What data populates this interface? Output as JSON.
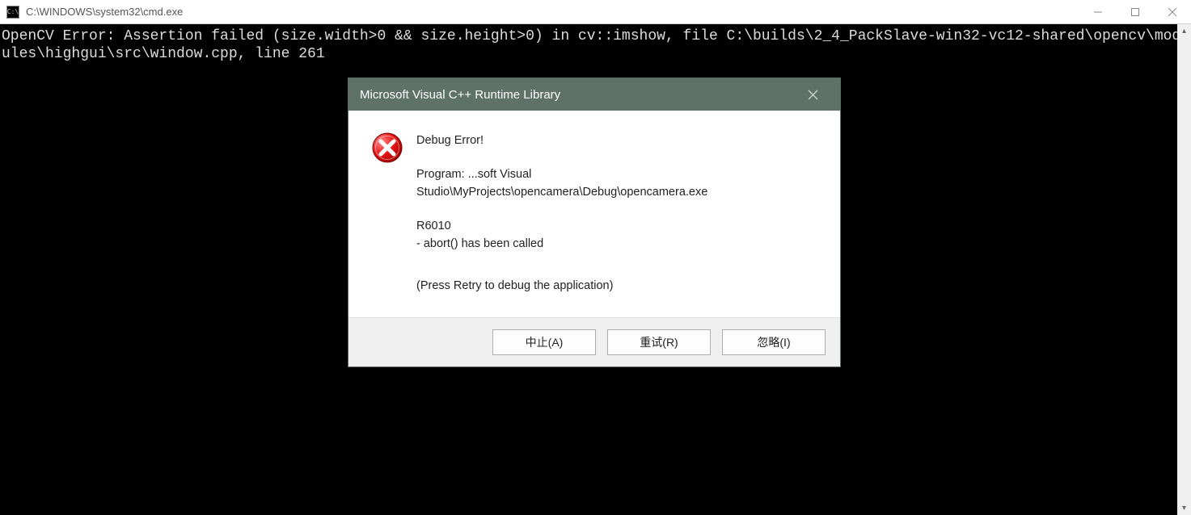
{
  "cmd": {
    "icon_text": "C:\\",
    "title": "C:\\WINDOWS\\system32\\cmd.exe",
    "output": "OpenCV Error: Assertion failed (size.width>0 && size.height>0) in cv::imshow, file C:\\builds\\2_4_PackSlave-win32-vc12-shared\\opencv\\modules\\highgui\\src\\window.cpp, line 261"
  },
  "dialog": {
    "title": "Microsoft Visual C++ Runtime Library",
    "heading": "Debug Error!",
    "program_label": "Program: ...soft Visual",
    "program_path": "Studio\\MyProjects\\opencamera\\Debug\\opencamera.exe",
    "error_code": "R6010",
    "error_desc": "- abort() has been called",
    "hint": "(Press Retry to debug the application)",
    "buttons": {
      "abort": "中止(A)",
      "retry": "重试(R)",
      "ignore": "忽略(I)"
    }
  }
}
